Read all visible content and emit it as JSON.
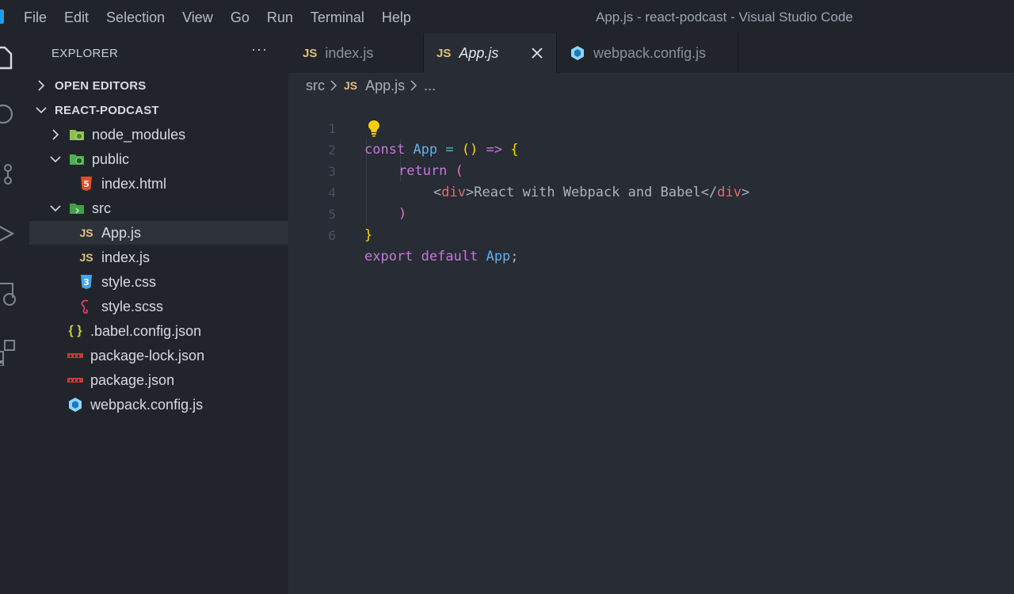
{
  "menu": [
    "File",
    "Edit",
    "Selection",
    "View",
    "Go",
    "Run",
    "Terminal",
    "Help"
  ],
  "window_title": "App.js - react-podcast - Visual Studio Code",
  "activity_icons": [
    "explorer-icon",
    "search-icon",
    "source-control-icon",
    "run-debug-icon",
    "remote-explorer-icon",
    "extensions-icon"
  ],
  "sidebar": {
    "title": "EXPLORER",
    "more": "···",
    "open_editors": "OPEN EDITORS",
    "project": "REACT-PODCAST",
    "tree": [
      {
        "name": "node_modules",
        "type": "folder",
        "expanded": false
      },
      {
        "name": "public",
        "type": "folder",
        "expanded": true
      },
      {
        "name": "index.html",
        "type": "html"
      },
      {
        "name": "src",
        "type": "folder",
        "expanded": true
      },
      {
        "name": "App.js",
        "type": "js",
        "selected": true
      },
      {
        "name": "index.js",
        "type": "js"
      },
      {
        "name": "style.css",
        "type": "css"
      },
      {
        "name": "style.scss",
        "type": "scss"
      },
      {
        "name": ".babel.config.json",
        "type": "json"
      },
      {
        "name": "package-lock.json",
        "type": "npm"
      },
      {
        "name": "package.json",
        "type": "npm"
      },
      {
        "name": "webpack.config.js",
        "type": "webpack"
      }
    ]
  },
  "tabs": [
    {
      "label": "index.js",
      "icon_text": "JS",
      "active": false
    },
    {
      "label": "App.js",
      "icon_text": "JS",
      "active": true
    },
    {
      "label": "webpack.config.js",
      "icon": "webpack-icon",
      "active": false
    }
  ],
  "breadcrumb": {
    "folder": "src",
    "file_icon": "JS",
    "file": "App.js",
    "more": "..."
  },
  "editor": {
    "line_numbers": [
      "1",
      "2",
      "3",
      "4",
      "5",
      "6"
    ],
    "lines": {
      "l1": {
        "kw": "const",
        "name": "App",
        "eq": "=",
        "parens": "()",
        "arrow": "=>",
        "brace": "{"
      },
      "l2": {
        "kw": "return",
        "paren": "("
      },
      "l3": {
        "lt": "<",
        "tag": "div",
        "gt": ">",
        "text": "React with Webpack and Babel",
        "lt2": "</",
        "tag2": "div",
        "gt2": ">"
      },
      "l4": {
        "paren": ")"
      },
      "l5": {
        "brace": "}"
      },
      "l6": {
        "kw1": "export",
        "kw2": "default",
        "name": "App",
        "semi": ";"
      }
    }
  },
  "colors": {
    "editor_bg": "#282c34",
    "sidebar_bg": "#21252b",
    "keyword": "#c678dd",
    "function": "#61afef",
    "tag": "#e06c75",
    "js_icon": "#e5c07b"
  }
}
